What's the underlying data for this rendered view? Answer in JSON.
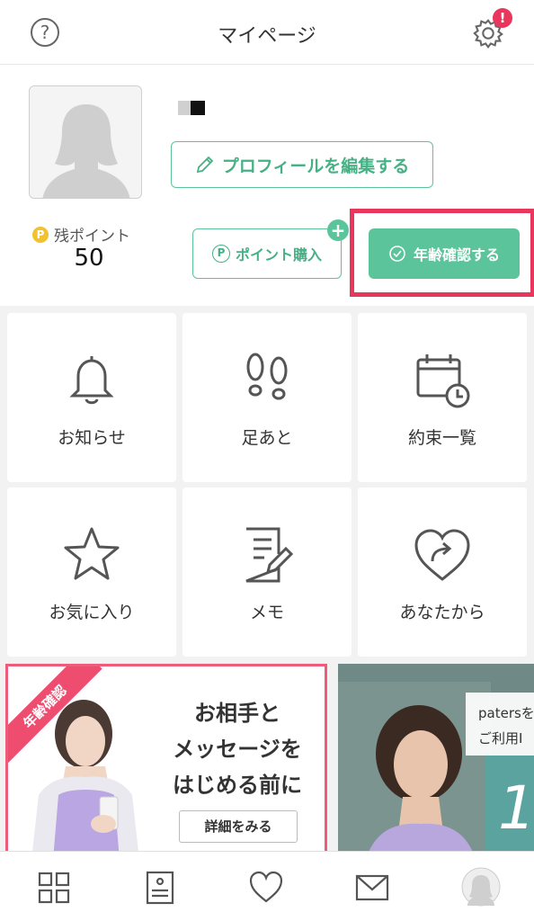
{
  "header": {
    "title": "マイページ",
    "help_symbol": "?",
    "notification_badge": "!"
  },
  "profile": {
    "edit_button": "プロフィールを編集する",
    "points_label": "残ポイント",
    "points_value": "50",
    "coin_symbol": "P",
    "buy_points_button": "ポイント購入",
    "buy_points_symbol": "P",
    "buy_points_plus": "+",
    "age_verify_button": "年齢確認する"
  },
  "menu": {
    "items": [
      {
        "label": "お知らせ",
        "icon": "bell-icon"
      },
      {
        "label": "足あと",
        "icon": "footprints-icon"
      },
      {
        "label": "約束一覧",
        "icon": "calendar-clock-icon"
      },
      {
        "label": "お気に入り",
        "icon": "star-icon"
      },
      {
        "label": "メモ",
        "icon": "memo-icon"
      },
      {
        "label": "あなたから",
        "icon": "heart-share-icon"
      }
    ]
  },
  "banners": {
    "left": {
      "ribbon": "年齢確認",
      "line1": "お相手と",
      "line2": "メッセージを",
      "line3": "はじめる前に",
      "detail_button": "詳細をみる"
    },
    "right": {
      "line1": "patersを",
      "line2": "ご利用I",
      "number": "1("
    }
  },
  "tabbar": {
    "icons": [
      "grid-icon",
      "list-icon",
      "heart-icon",
      "mail-icon",
      "avatar-icon"
    ]
  },
  "colors": {
    "accent_green": "#5cc49b",
    "highlight_red": "#e8365d",
    "ribbon_pink": "#ef4d70"
  }
}
